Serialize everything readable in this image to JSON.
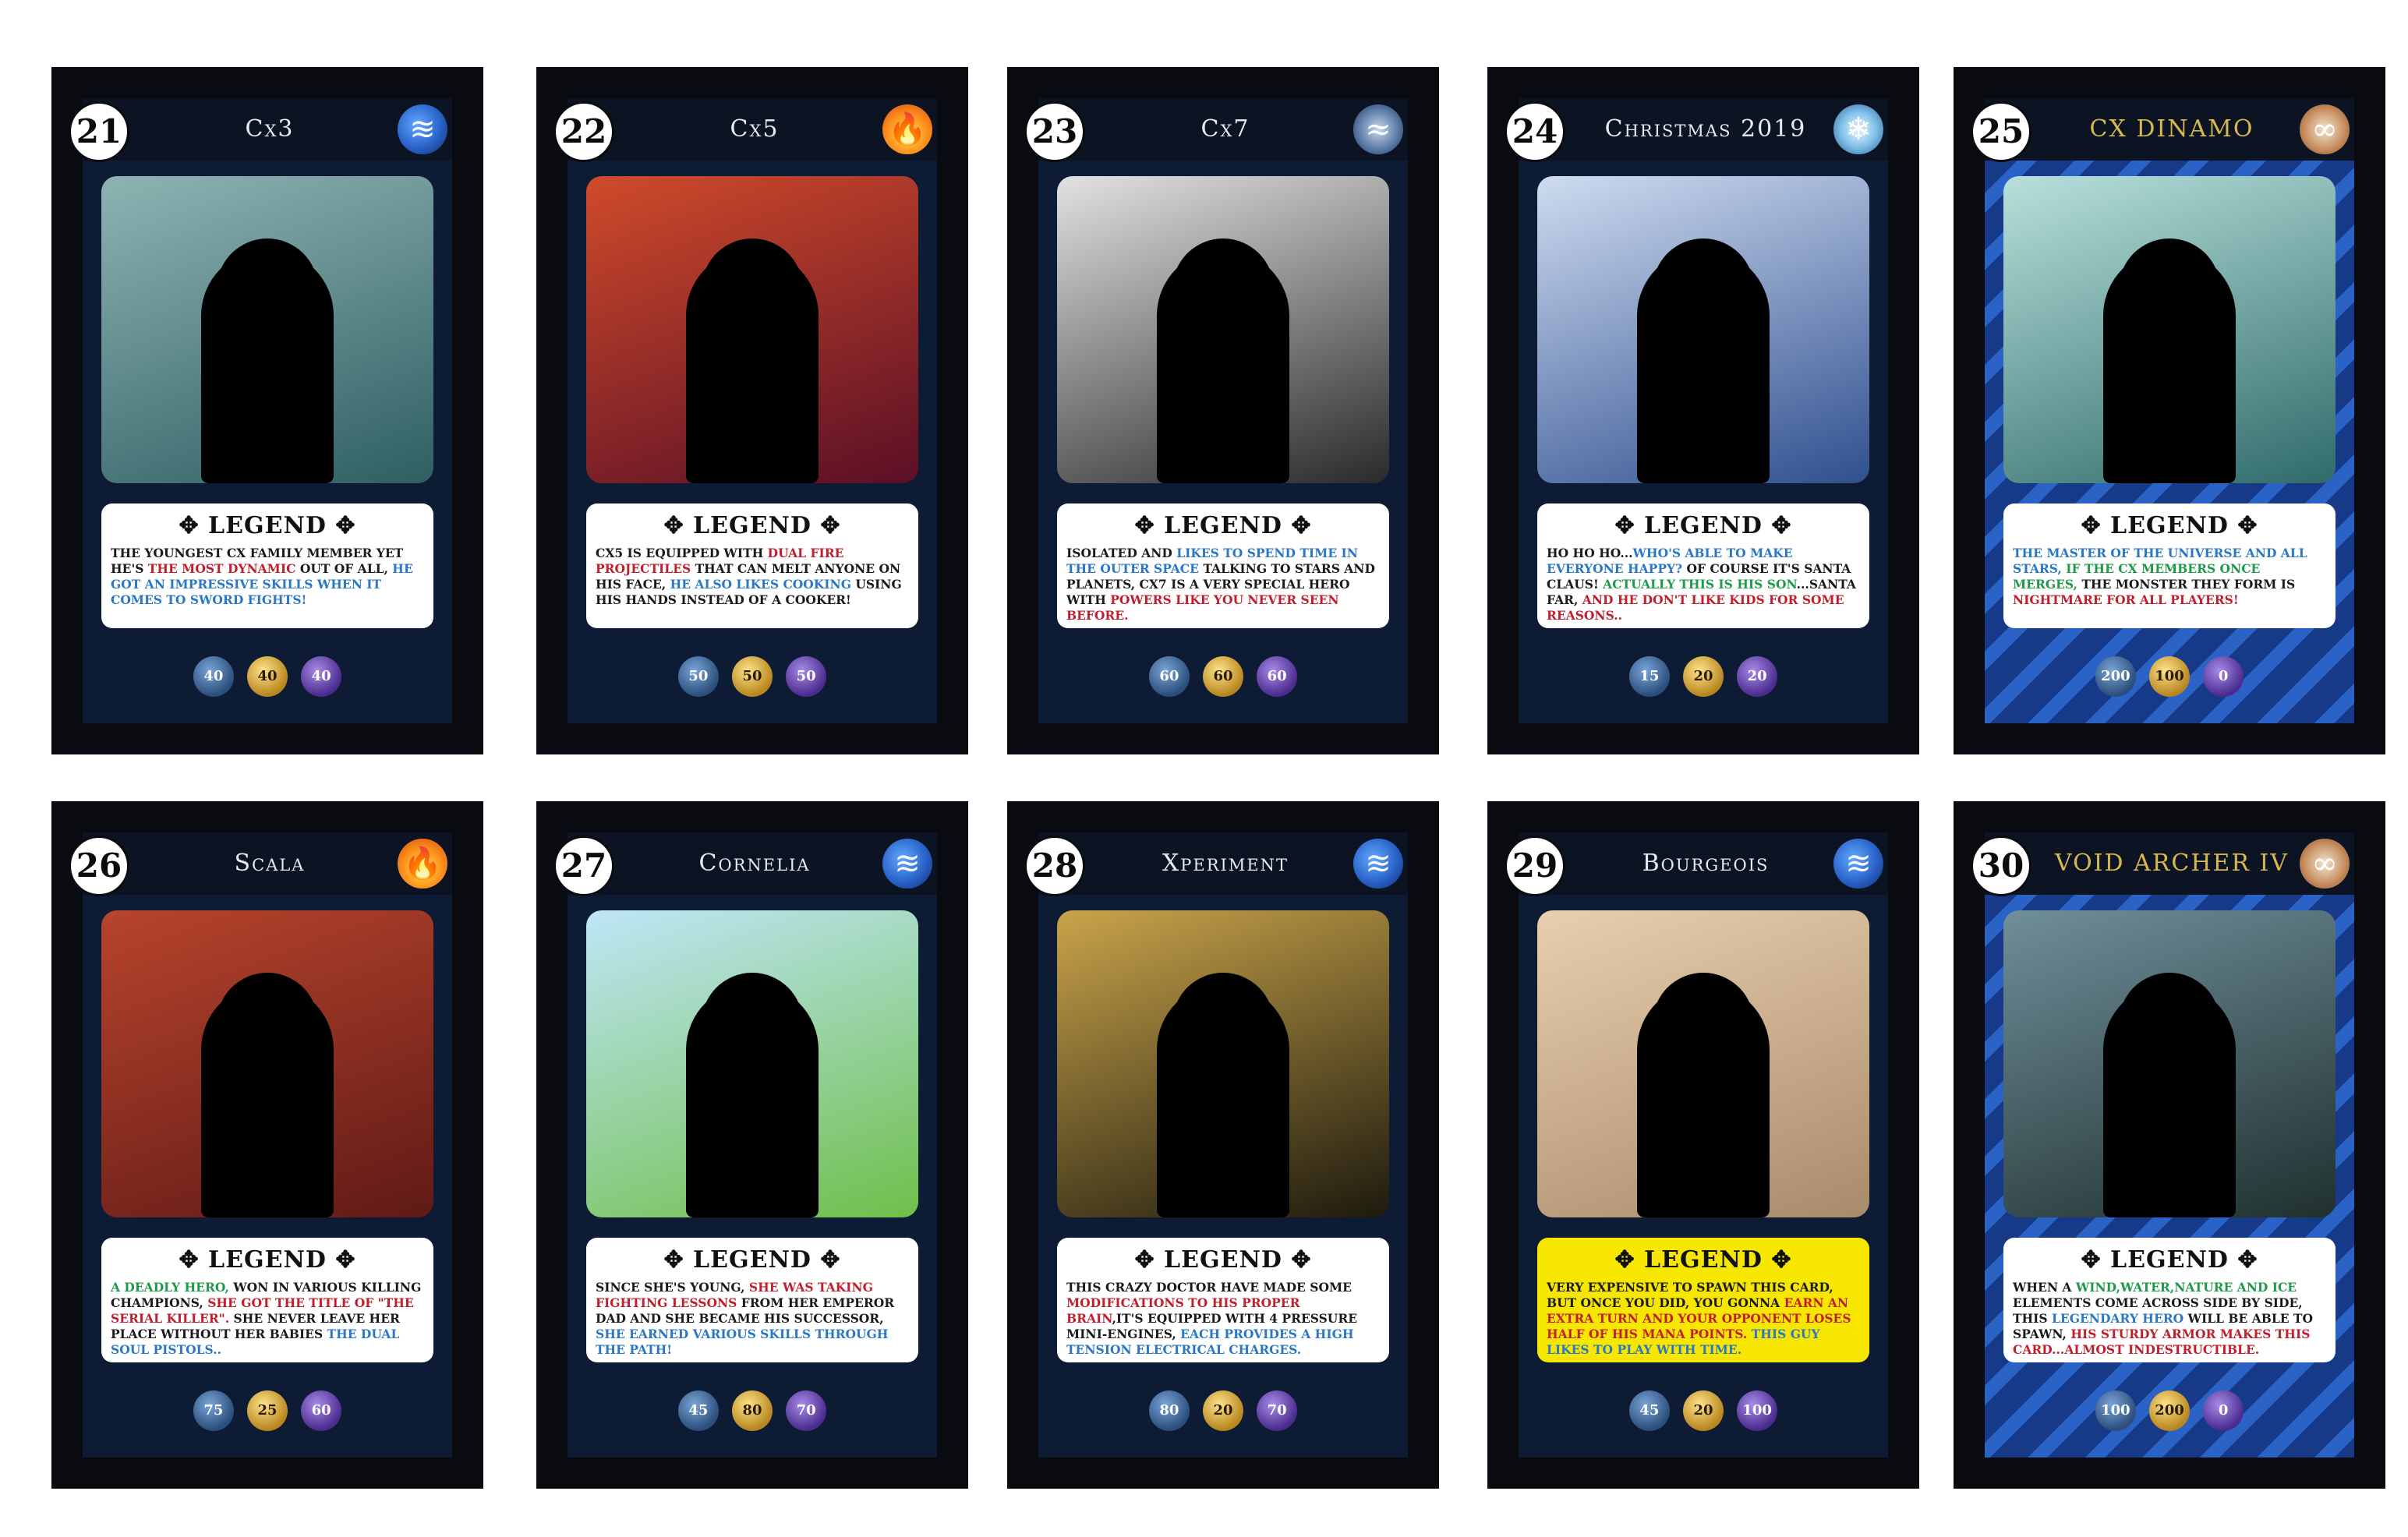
{
  "legend_label": "LEGEND",
  "legend_ornament": "✥",
  "icons": {
    "water": "water-element-icon",
    "fire": "fire-element-icon",
    "wind": "wind-element-icon",
    "ice": "ice-element-icon",
    "infinity": "infinity-element-icon",
    "attack": "attack-stat-icon",
    "gold": "gold-stat-icon",
    "mana": "mana-stat-icon"
  },
  "cards": [
    {
      "number": "21",
      "name": "Cx3",
      "element": "water",
      "glyph": "≋",
      "style": "normal",
      "art_colors": [
        "#8fb3b3",
        "#2e5f62"
      ],
      "desc": [
        [
          "The youngest cx family member yet he's ",
          ""
        ],
        [
          "the most dynamic",
          "red"
        ],
        [
          " out of all, ",
          ""
        ],
        [
          "he got an impressive skills when it comes to sword fights!",
          "blue"
        ]
      ],
      "stats": [
        "40",
        "40",
        "40"
      ]
    },
    {
      "number": "22",
      "name": "Cx5",
      "element": "fire",
      "glyph": "🔥",
      "style": "normal",
      "art_colors": [
        "#d04b2a",
        "#5a0f26"
      ],
      "desc": [
        [
          "Cx5 is equipped with ",
          ""
        ],
        [
          "dual fire projectiles",
          "red"
        ],
        [
          " that can melt anyone on his face, ",
          ""
        ],
        [
          "he also likes cooking",
          "blue"
        ],
        [
          " using his hands instead of a cooker!",
          ""
        ]
      ],
      "stats": [
        "50",
        "50",
        "50"
      ]
    },
    {
      "number": "23",
      "name": "Cx7",
      "element": "wind",
      "glyph": "≈",
      "style": "normal",
      "art_colors": [
        "#e2e2e2",
        "#2a2a2a"
      ],
      "desc": [
        [
          "Isolated and ",
          ""
        ],
        [
          "likes to spend time in the outer space",
          "blue"
        ],
        [
          " talking to stars and planets, cx7 is a very special hero with ",
          ""
        ],
        [
          "powers like you never seen before.",
          "red"
        ]
      ],
      "stats": [
        "60",
        "60",
        "60"
      ]
    },
    {
      "number": "24",
      "name": "Christmas 2019",
      "element": "ice",
      "glyph": "❄",
      "style": "normal",
      "art_colors": [
        "#cfdcf0",
        "#2f4f8f"
      ],
      "desc": [
        [
          "Ho ho ho...",
          ""
        ],
        [
          "who's able to make everyone happy?",
          "blue"
        ],
        [
          " of course it's santa claus! ",
          ""
        ],
        [
          "actually this is his son",
          "green"
        ],
        [
          "...santa far, ",
          ""
        ],
        [
          "and he don't like kids for some reasons..",
          "red"
        ]
      ],
      "stats": [
        "15",
        "20",
        "20"
      ]
    },
    {
      "number": "25",
      "name": "CX DINAMO",
      "element": "infinity",
      "glyph": "∞",
      "style": "cx",
      "art_colors": [
        "#b8e0dc",
        "#2f6b6a"
      ],
      "desc": [
        [
          "The master of the universe and all stars, ",
          "blue"
        ],
        [
          "if the cx members once merges,",
          "green"
        ],
        [
          " the monster they form is ",
          ""
        ],
        [
          "nightmare for all players!",
          "red"
        ]
      ],
      "stats": [
        "200",
        "100",
        "0"
      ]
    },
    {
      "number": "26",
      "name": "Scala",
      "element": "fire",
      "glyph": "🔥",
      "style": "normal",
      "art_colors": [
        "#b8442c",
        "#5f1a16"
      ],
      "desc": [
        [
          "A deadly hero,",
          "green"
        ],
        [
          " won in various killing champions, ",
          ""
        ],
        [
          "she got the title of \"The serial killer\".",
          "red"
        ],
        [
          " She never leave her place without her babies ",
          ""
        ],
        [
          "the Dual soul pistols..",
          "blue"
        ]
      ],
      "stats": [
        "75",
        "25",
        "60"
      ]
    },
    {
      "number": "27",
      "name": "Cornelia",
      "element": "water",
      "glyph": "≋",
      "style": "normal",
      "art_colors": [
        "#bfe6f7",
        "#6fbf4a"
      ],
      "desc": [
        [
          "Since she's young, ",
          ""
        ],
        [
          "she was taking fighting lessons",
          "red"
        ],
        [
          " from her emperor dad and she became his successor, ",
          ""
        ],
        [
          "she earned various skills through the path!",
          "blue"
        ]
      ],
      "stats": [
        "45",
        "80",
        "70"
      ]
    },
    {
      "number": "28",
      "name": "Xperiment",
      "element": "water",
      "glyph": "≋",
      "style": "normal",
      "art_colors": [
        "#c9a44a",
        "#1d1a0e"
      ],
      "desc": [
        [
          "This crazy doctor have made some ",
          ""
        ],
        [
          "modifications to his proper brain",
          "red"
        ],
        [
          ",it's equipped with 4 pressure mini-engines, ",
          ""
        ],
        [
          "each provides a high tension electrical charges.",
          "blue"
        ]
      ],
      "stats": [
        "80",
        "20",
        "70"
      ]
    },
    {
      "number": "29",
      "name": "Bourgeois",
      "element": "water",
      "glyph": "≋",
      "style": "yellow",
      "art_colors": [
        "#e9cfae",
        "#a88b6a"
      ],
      "desc": [
        [
          "Very expensive to spawn this card, but once you did, you gonna ",
          ""
        ],
        [
          "earn an extra turn and your opponent loses half of his mana points.",
          "red"
        ],
        [
          " This guy likes to play with time.",
          "blue"
        ]
      ],
      "stats": [
        "45",
        "20",
        "100"
      ]
    },
    {
      "number": "30",
      "name": "VOID ARCHER IV",
      "element": "infinity",
      "glyph": "∞",
      "style": "cx",
      "art_colors": [
        "#6f8f9a",
        "#20302f"
      ],
      "desc": [
        [
          "When a ",
          ""
        ],
        [
          "wind,water,nature and ice",
          "green"
        ],
        [
          " elements come across side by side, this ",
          ""
        ],
        [
          "legendary hero",
          "blue"
        ],
        [
          " will be able to spawn, ",
          ""
        ],
        [
          "his sturdy armor makes this card...almost indestructible.",
          "red"
        ]
      ],
      "stats": [
        "100",
        "200",
        "0"
      ]
    }
  ]
}
